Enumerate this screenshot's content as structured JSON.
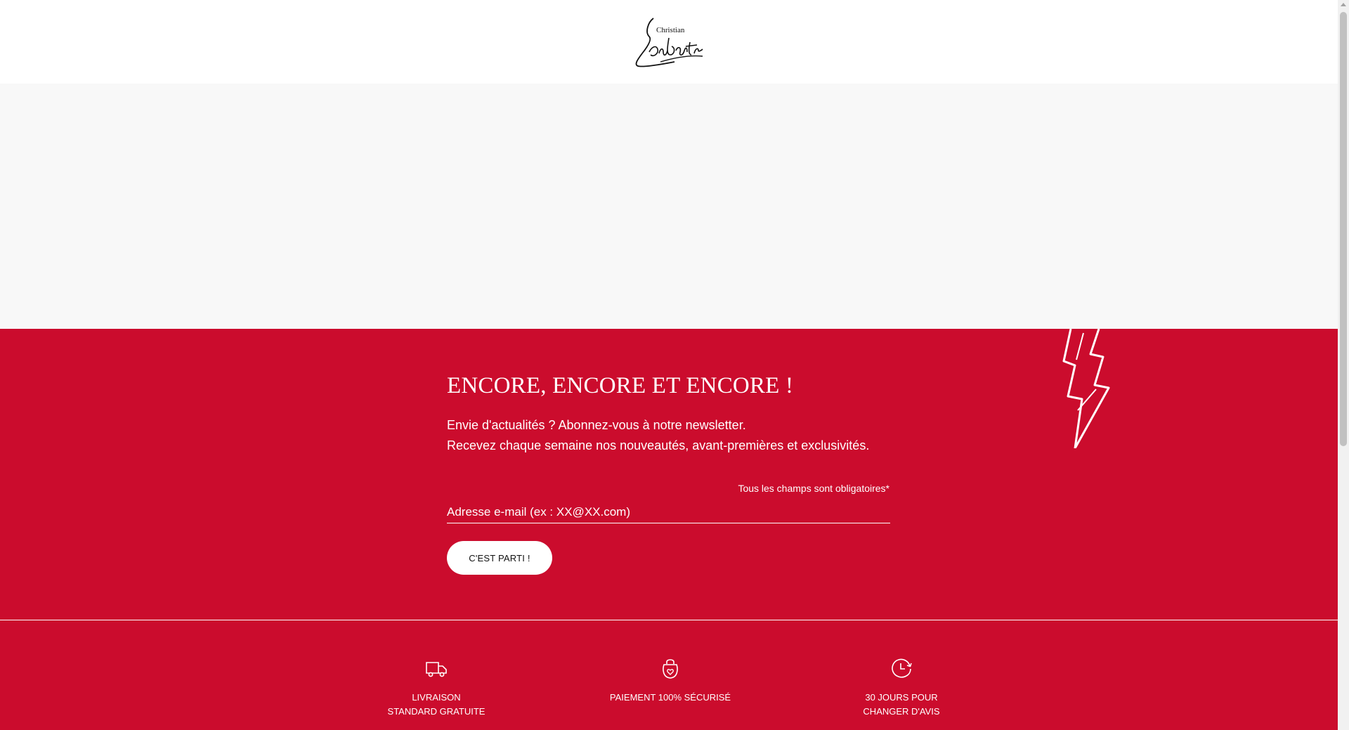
{
  "header": {
    "logo_small": "Christian",
    "logo_alt": "Christian Louboutin"
  },
  "newsletter": {
    "title": "ENCORE, ENCORE ET ENCORE !",
    "line1": "Envie d'actualités ? Abonnez-vous à notre newsletter.",
    "line2": "Recevez chaque semaine nos nouveautés, avant-premières et exclusivités.",
    "required_note": "Tous les champs sont obligatoires*",
    "email_placeholder": "Adresse e-mail (ex : XX@XX.com)",
    "email_value": "",
    "submit_label": "C'EST PARTI !"
  },
  "reassurance": {
    "items": [
      {
        "icon": "delivery-truck-icon",
        "line1": "LIVRAISON",
        "line2": "STANDARD GRATUITE"
      },
      {
        "icon": "secure-bag-icon",
        "line1": "PAIEMENT 100% SÉCURISÉ",
        "line2": ""
      },
      {
        "icon": "clock-return-icon",
        "line1": "30 JOURS POUR",
        "line2": "CHANGER D'AVIS"
      }
    ]
  },
  "colors": {
    "brand_red": "#cb0c2d",
    "hero_bg": "#f8f8f8",
    "white": "#ffffff"
  }
}
